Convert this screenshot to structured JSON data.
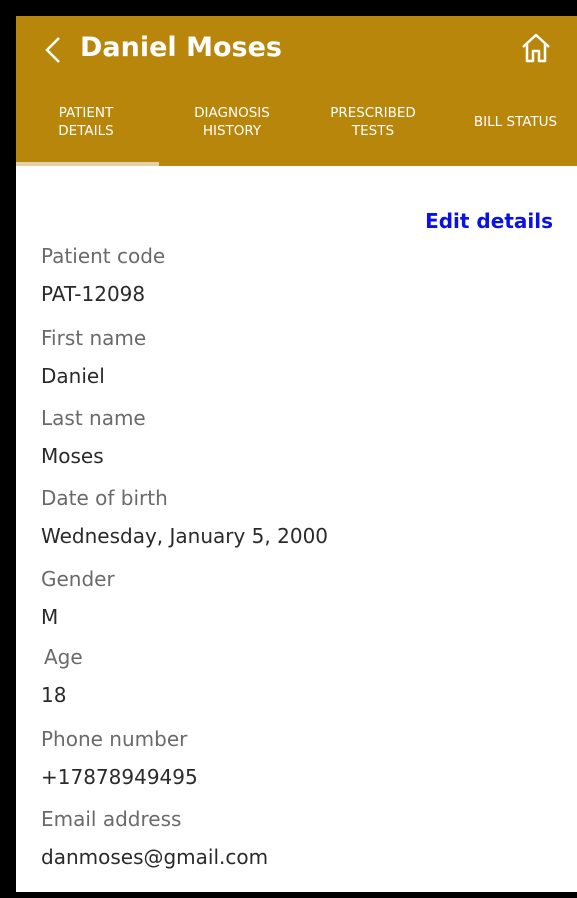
{
  "header": {
    "title": "Daniel Moses",
    "back_icon": "chevron-left-icon",
    "home_icon": "home-icon",
    "background_color": "#b8860b"
  },
  "tabs": [
    {
      "line1": "PATIENT",
      "line2": "DETAILS",
      "selected": true
    },
    {
      "line1": "DIAGNOSIS",
      "line2": "HISTORY",
      "selected": false
    },
    {
      "line1": "PRESCRIBED",
      "line2": "TESTS",
      "selected": false
    },
    {
      "line1": "BILL STATUS",
      "line2": "",
      "selected": false
    }
  ],
  "edit_label": "Edit details",
  "fields": [
    {
      "label": "Patient code",
      "value": "PAT-12098"
    },
    {
      "label": "First name",
      "value": "Daniel"
    },
    {
      "label": "Last name",
      "value": "Moses"
    },
    {
      "label": "Date of birth",
      "value": "Wednesday, January 5, 2000"
    },
    {
      "label": "Gender",
      "value": "M"
    },
    {
      "label": "Age",
      "value": "18"
    },
    {
      "label": "Phone number",
      "value": "+17878949495"
    },
    {
      "label": "Email address",
      "value": "danmoses@gmail.com"
    }
  ]
}
